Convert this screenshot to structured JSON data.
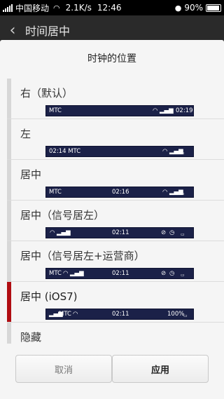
{
  "status": {
    "carrier": "中国移动",
    "speed": "2.1K/s",
    "time": "12:46",
    "battery": "90%"
  },
  "header": {
    "title": "时间居中"
  },
  "dialog": {
    "title": "时钟的位置",
    "options": [
      {
        "label": "右（默认）",
        "preview": {
          "left": "MTC",
          "center": "",
          "right": "02:19"
        }
      },
      {
        "label": "左",
        "preview": {
          "left": "02:14  MTC",
          "center": "",
          "right": ""
        }
      },
      {
        "label": "居中",
        "preview": {
          "left": "MTC",
          "center": "02:16",
          "right": ""
        }
      },
      {
        "label": "居中（信号居左）",
        "preview": {
          "left": "",
          "center": "02:11",
          "right": ""
        }
      },
      {
        "label": "居中（信号居左+运营商）",
        "preview": {
          "left": "MTC",
          "center": "02:11",
          "right": ""
        }
      },
      {
        "label": "居中 (iOS7)",
        "preview": {
          "left": "MTC",
          "center": "02:11",
          "right": "100%"
        }
      },
      {
        "label": "隐藏"
      }
    ],
    "selected_index": 5,
    "cancel_label": "取消",
    "apply_label": "应用"
  },
  "colors": {
    "accent": "#b00d12",
    "preview_bg": "#1b2148",
    "title_bg": "#2a2a2a"
  },
  "icons": [
    "signal-icon",
    "wifi-icon",
    "back-icon",
    "alarm-icon",
    "mute-icon",
    "battery-icon",
    "cat-icon"
  ]
}
